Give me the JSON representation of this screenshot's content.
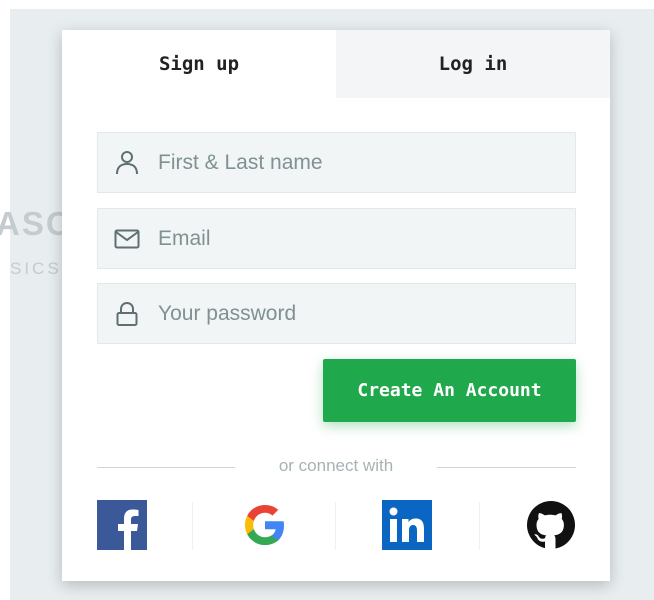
{
  "background": {
    "brand_fragment": "ASC",
    "tagline_fragment": "SICS."
  },
  "tabs": [
    {
      "label": "Sign up",
      "active": true
    },
    {
      "label": "Log in",
      "active": false
    }
  ],
  "form": {
    "name_placeholder": "First & Last name",
    "email_placeholder": "Email",
    "password_placeholder": "Your password",
    "name_icon": "user-icon",
    "email_icon": "envelope-icon",
    "password_icon": "lock-icon",
    "submit_label": "Create An Account"
  },
  "social": {
    "divider_text": "or connect with",
    "providers": [
      {
        "name": "facebook",
        "icon": "facebook-icon",
        "color": "#3b5998"
      },
      {
        "name": "google",
        "icon": "google-icon",
        "color": "#4285f4"
      },
      {
        "name": "linkedin",
        "icon": "linkedin-icon",
        "color": "#0a66c2"
      },
      {
        "name": "github",
        "icon": "github-icon",
        "color": "#111111"
      }
    ]
  },
  "colors": {
    "accent": "#20a84c",
    "page_background": "#e8eef0",
    "field_background": "#f2f5f6",
    "inactive_tab": "#f3f5f6"
  }
}
